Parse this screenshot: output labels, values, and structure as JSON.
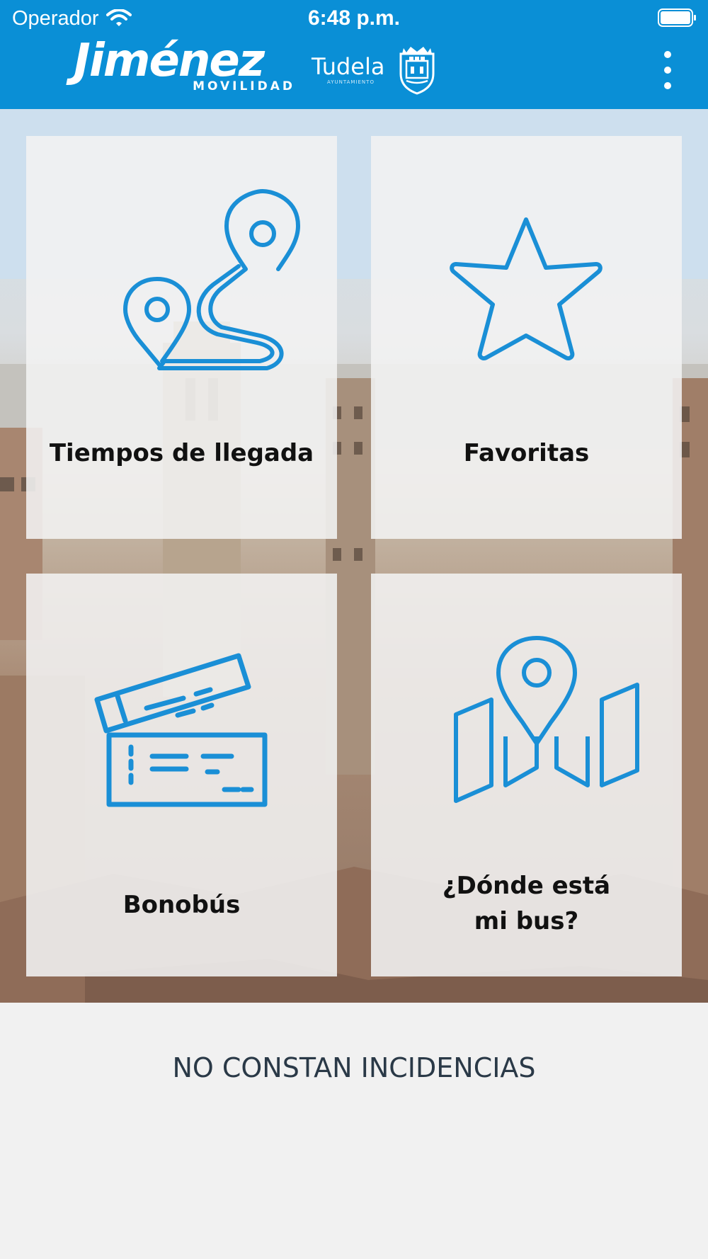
{
  "status_bar": {
    "carrier": "Operador",
    "time": "6:48 p.m."
  },
  "header": {
    "brand_name": "Jiménez",
    "brand_sub": "MOVILIDAD",
    "partner_name": "Tudela",
    "partner_sub": "AYUNTAMIENTO"
  },
  "tiles": [
    {
      "label": "Tiempos de llegada",
      "icon": "route-pins-icon"
    },
    {
      "label": "Favoritas",
      "icon": "star-icon"
    },
    {
      "label": "Bonobús",
      "icon": "tickets-icon"
    },
    {
      "label_line1": "¿Dónde está",
      "label_line2": "mi bus?",
      "icon": "map-pin-icon"
    }
  ],
  "footer": {
    "incidents": "NO CONSTAN INCIDENCIAS"
  },
  "colors": {
    "brand_blue": "#0a8fd6",
    "icon_blue": "#1a8fd6",
    "text_dark": "#2a3947"
  }
}
